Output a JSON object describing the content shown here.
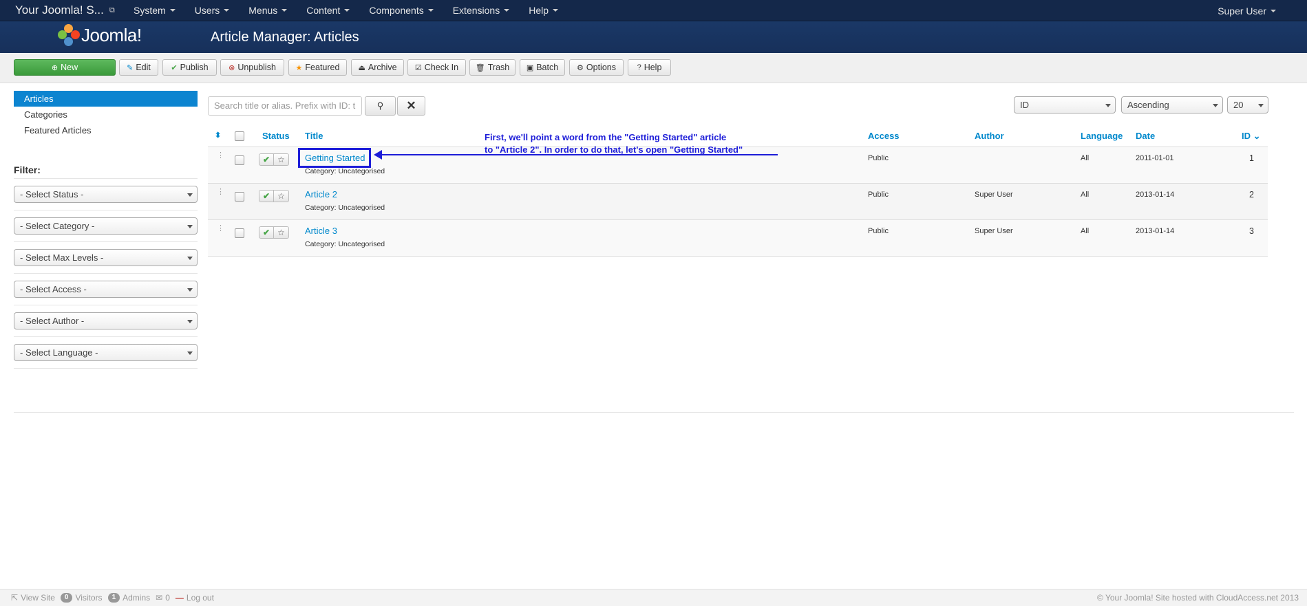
{
  "topbar": {
    "brand": "Your Joomla! S...",
    "menu": [
      "System",
      "Users",
      "Menus",
      "Content",
      "Components",
      "Extensions",
      "Help"
    ],
    "user": "Super User"
  },
  "header": {
    "logo_text": "Joomla!",
    "title": "Article Manager: Articles"
  },
  "toolbar": {
    "buttons": [
      {
        "label": "New",
        "icon": "plus-circle-icon"
      },
      {
        "label": "Edit",
        "icon": "edit-icon"
      },
      {
        "label": "Publish",
        "icon": "check-icon"
      },
      {
        "label": "Unpublish",
        "icon": "x-circle-icon"
      },
      {
        "label": "Featured",
        "icon": "star-icon"
      },
      {
        "label": "Archive",
        "icon": "archive-icon"
      },
      {
        "label": "Check In",
        "icon": "checkbox-icon"
      },
      {
        "label": "Trash",
        "icon": "trash-icon"
      },
      {
        "label": "Batch",
        "icon": "batch-icon"
      },
      {
        "label": "Options",
        "icon": "gear-icon"
      },
      {
        "label": "Help",
        "icon": "question-icon"
      }
    ]
  },
  "sidebar": {
    "items": [
      "Articles",
      "Categories",
      "Featured Articles"
    ],
    "filter_title": "Filter:",
    "filters": [
      "- Select Status -",
      "- Select Category -",
      "- Select Max Levels -",
      "- Select Access -",
      "- Select Author -",
      "- Select Language -"
    ]
  },
  "search": {
    "placeholder": "Search title or alias. Prefix with ID: t"
  },
  "ordering": {
    "sort_field": "ID",
    "direction": "Ascending",
    "limit": "20"
  },
  "table": {
    "headers": {
      "status": "Status",
      "title": "Title",
      "access": "Access",
      "author": "Author",
      "language": "Language",
      "date": "Date",
      "id": "ID"
    },
    "rows": [
      {
        "title": "Getting Started",
        "category": "Category: Uncategorised",
        "access": "Public",
        "author": "",
        "language": "All",
        "date": "2011-01-01",
        "id": "1"
      },
      {
        "title": "Article 2",
        "category": "Category: Uncategorised",
        "access": "Public",
        "author": "Super User",
        "language": "All",
        "date": "2013-01-14",
        "id": "2"
      },
      {
        "title": "Article 3",
        "category": "Category: Uncategorised",
        "access": "Public",
        "author": "Super User",
        "language": "All",
        "date": "2013-01-14",
        "id": "3"
      }
    ]
  },
  "annotation": {
    "line1": "First, we'll point a word from the \"Getting Started\" article",
    "line2": "to \"Article 2\". In order to do that, let's open \"Getting Started\""
  },
  "footer": {
    "view_site": "View Site",
    "visitors_count": "0",
    "visitors": "Visitors",
    "admins_count": "1",
    "admins": "Admins",
    "messages_count": "0",
    "logout": "Log out",
    "copyright": "© Your Joomla! Site hosted with CloudAccess.net 2013"
  }
}
